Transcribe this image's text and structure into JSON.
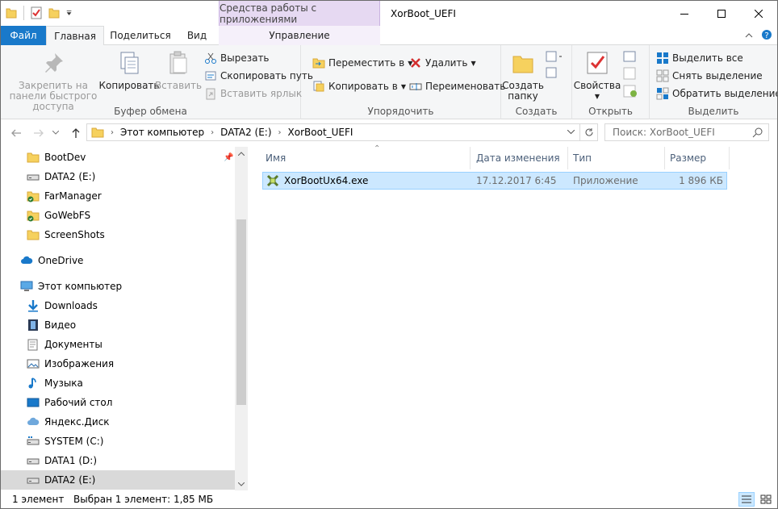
{
  "window": {
    "title": "XorBoot_UEFI",
    "context_tab_title": "Средства работы с приложениями"
  },
  "tabs": {
    "file": "Файл",
    "home": "Главная",
    "share": "Поделиться",
    "view": "Вид",
    "manage": "Управление"
  },
  "ribbon": {
    "clipboard": {
      "label": "Буфер обмена",
      "pin": "Закрепить на панели быстрого доступа",
      "copy": "Копировать",
      "paste": "Вставить",
      "cut": "Вырезать",
      "copy_path": "Скопировать путь",
      "paste_shortcut": "Вставить ярлык"
    },
    "organize": {
      "label": "Упорядочить",
      "move_to": "Переместить в",
      "copy_to": "Копировать в",
      "delete": "Удалить",
      "rename": "Переименовать"
    },
    "new": {
      "label": "Создать",
      "new_folder": "Создать папку"
    },
    "open": {
      "label": "Открыть",
      "properties": "Свойства"
    },
    "select": {
      "label": "Выделить",
      "select_all": "Выделить все",
      "select_none": "Снять выделение",
      "invert": "Обратить выделение"
    }
  },
  "address": {
    "crumbs": [
      "Этот компьютер",
      "DATA2 (E:)",
      "XorBoot_UEFI"
    ],
    "search_placeholder": "Поиск: XorBoot_UEFI"
  },
  "nav": {
    "items": [
      {
        "label": "BootDev",
        "icon": "folder-icon"
      },
      {
        "label": "DATA2 (E:)",
        "icon": "drive-icon"
      },
      {
        "label": "FarManager",
        "icon": "folder-sync-icon"
      },
      {
        "label": "GoWebFS",
        "icon": "folder-sync-icon"
      },
      {
        "label": "ScreenShots",
        "icon": "folder-icon"
      },
      {
        "label": "OneDrive",
        "icon": "cloud-icon"
      },
      {
        "label": "Этот компьютер",
        "icon": "computer-icon"
      },
      {
        "label": "Downloads",
        "icon": "download-icon"
      },
      {
        "label": "Видео",
        "icon": "video-icon"
      },
      {
        "label": "Документы",
        "icon": "documents-icon"
      },
      {
        "label": "Изображения",
        "icon": "pictures-icon"
      },
      {
        "label": "Музыка",
        "icon": "music-icon"
      },
      {
        "label": "Рабочий стол",
        "icon": "desktop-icon"
      },
      {
        "label": "Яндекс.Диск",
        "icon": "cloud-icon"
      },
      {
        "label": "SYSTEM (C:)",
        "icon": "system-drive-icon"
      },
      {
        "label": "DATA1 (D:)",
        "icon": "drive-icon"
      },
      {
        "label": "DATA2 (E:)",
        "icon": "drive-icon"
      }
    ]
  },
  "columns": {
    "name": "Имя",
    "date": "Дата изменения",
    "type": "Тип",
    "size": "Размер"
  },
  "files": [
    {
      "name": "XorBootUx64.exe",
      "date": "17.12.2017 6:45",
      "type": "Приложение",
      "size": "1 896 КБ"
    }
  ],
  "status": {
    "count": "1 элемент",
    "selection": "Выбран 1 элемент: 1,85 МБ"
  },
  "colors": {
    "file_tab": "#1979ca",
    "context_tab": "#e6d9f2",
    "selection": "#cce8ff",
    "selection_border": "#99d1ff"
  }
}
